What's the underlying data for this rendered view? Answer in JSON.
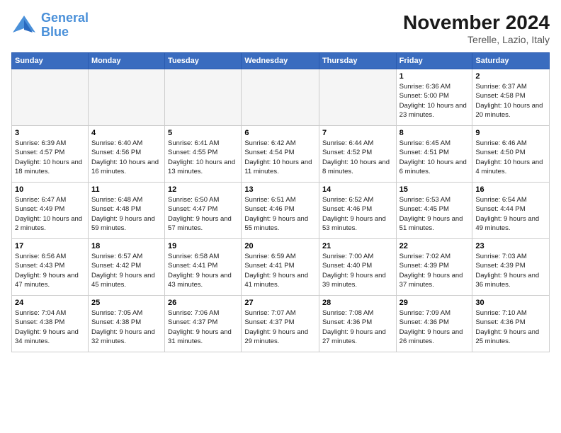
{
  "logo": {
    "line1": "General",
    "line2": "Blue"
  },
  "title": "November 2024",
  "location": "Terelle, Lazio, Italy",
  "days_header": [
    "Sunday",
    "Monday",
    "Tuesday",
    "Wednesday",
    "Thursday",
    "Friday",
    "Saturday"
  ],
  "weeks": [
    [
      {
        "day": "",
        "info": ""
      },
      {
        "day": "",
        "info": ""
      },
      {
        "day": "",
        "info": ""
      },
      {
        "day": "",
        "info": ""
      },
      {
        "day": "",
        "info": ""
      },
      {
        "day": "1",
        "info": "Sunrise: 6:36 AM\nSunset: 5:00 PM\nDaylight: 10 hours and 23 minutes."
      },
      {
        "day": "2",
        "info": "Sunrise: 6:37 AM\nSunset: 4:58 PM\nDaylight: 10 hours and 20 minutes."
      }
    ],
    [
      {
        "day": "3",
        "info": "Sunrise: 6:39 AM\nSunset: 4:57 PM\nDaylight: 10 hours and 18 minutes."
      },
      {
        "day": "4",
        "info": "Sunrise: 6:40 AM\nSunset: 4:56 PM\nDaylight: 10 hours and 16 minutes."
      },
      {
        "day": "5",
        "info": "Sunrise: 6:41 AM\nSunset: 4:55 PM\nDaylight: 10 hours and 13 minutes."
      },
      {
        "day": "6",
        "info": "Sunrise: 6:42 AM\nSunset: 4:54 PM\nDaylight: 10 hours and 11 minutes."
      },
      {
        "day": "7",
        "info": "Sunrise: 6:44 AM\nSunset: 4:52 PM\nDaylight: 10 hours and 8 minutes."
      },
      {
        "day": "8",
        "info": "Sunrise: 6:45 AM\nSunset: 4:51 PM\nDaylight: 10 hours and 6 minutes."
      },
      {
        "day": "9",
        "info": "Sunrise: 6:46 AM\nSunset: 4:50 PM\nDaylight: 10 hours and 4 minutes."
      }
    ],
    [
      {
        "day": "10",
        "info": "Sunrise: 6:47 AM\nSunset: 4:49 PM\nDaylight: 10 hours and 2 minutes."
      },
      {
        "day": "11",
        "info": "Sunrise: 6:48 AM\nSunset: 4:48 PM\nDaylight: 9 hours and 59 minutes."
      },
      {
        "day": "12",
        "info": "Sunrise: 6:50 AM\nSunset: 4:47 PM\nDaylight: 9 hours and 57 minutes."
      },
      {
        "day": "13",
        "info": "Sunrise: 6:51 AM\nSunset: 4:46 PM\nDaylight: 9 hours and 55 minutes."
      },
      {
        "day": "14",
        "info": "Sunrise: 6:52 AM\nSunset: 4:46 PM\nDaylight: 9 hours and 53 minutes."
      },
      {
        "day": "15",
        "info": "Sunrise: 6:53 AM\nSunset: 4:45 PM\nDaylight: 9 hours and 51 minutes."
      },
      {
        "day": "16",
        "info": "Sunrise: 6:54 AM\nSunset: 4:44 PM\nDaylight: 9 hours and 49 minutes."
      }
    ],
    [
      {
        "day": "17",
        "info": "Sunrise: 6:56 AM\nSunset: 4:43 PM\nDaylight: 9 hours and 47 minutes."
      },
      {
        "day": "18",
        "info": "Sunrise: 6:57 AM\nSunset: 4:42 PM\nDaylight: 9 hours and 45 minutes."
      },
      {
        "day": "19",
        "info": "Sunrise: 6:58 AM\nSunset: 4:41 PM\nDaylight: 9 hours and 43 minutes."
      },
      {
        "day": "20",
        "info": "Sunrise: 6:59 AM\nSunset: 4:41 PM\nDaylight: 9 hours and 41 minutes."
      },
      {
        "day": "21",
        "info": "Sunrise: 7:00 AM\nSunset: 4:40 PM\nDaylight: 9 hours and 39 minutes."
      },
      {
        "day": "22",
        "info": "Sunrise: 7:02 AM\nSunset: 4:39 PM\nDaylight: 9 hours and 37 minutes."
      },
      {
        "day": "23",
        "info": "Sunrise: 7:03 AM\nSunset: 4:39 PM\nDaylight: 9 hours and 36 minutes."
      }
    ],
    [
      {
        "day": "24",
        "info": "Sunrise: 7:04 AM\nSunset: 4:38 PM\nDaylight: 9 hours and 34 minutes."
      },
      {
        "day": "25",
        "info": "Sunrise: 7:05 AM\nSunset: 4:38 PM\nDaylight: 9 hours and 32 minutes."
      },
      {
        "day": "26",
        "info": "Sunrise: 7:06 AM\nSunset: 4:37 PM\nDaylight: 9 hours and 31 minutes."
      },
      {
        "day": "27",
        "info": "Sunrise: 7:07 AM\nSunset: 4:37 PM\nDaylight: 9 hours and 29 minutes."
      },
      {
        "day": "28",
        "info": "Sunrise: 7:08 AM\nSunset: 4:36 PM\nDaylight: 9 hours and 27 minutes."
      },
      {
        "day": "29",
        "info": "Sunrise: 7:09 AM\nSunset: 4:36 PM\nDaylight: 9 hours and 26 minutes."
      },
      {
        "day": "30",
        "info": "Sunrise: 7:10 AM\nSunset: 4:36 PM\nDaylight: 9 hours and 25 minutes."
      }
    ]
  ]
}
